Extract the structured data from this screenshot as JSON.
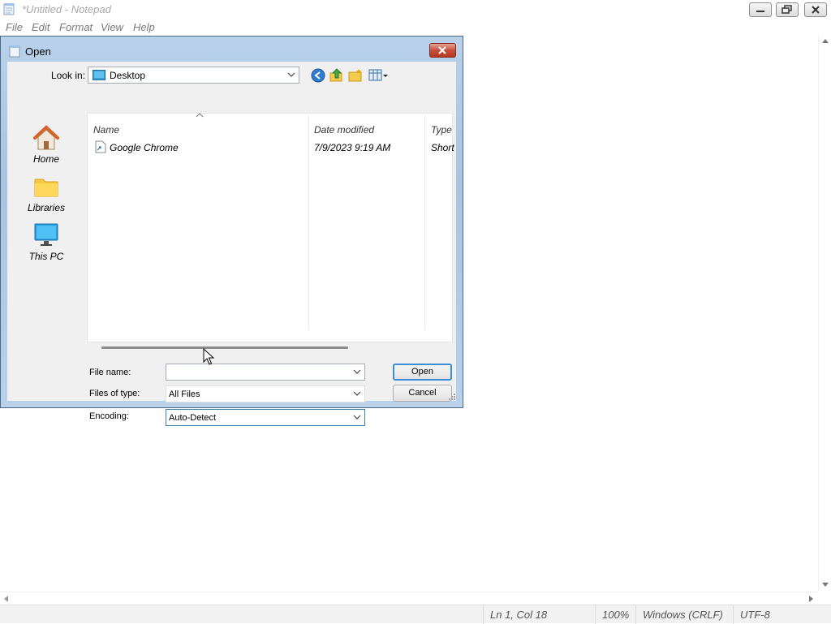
{
  "window": {
    "title": "*Untitled - Notepad",
    "menu": [
      "File",
      "Edit",
      "Format",
      "View",
      "Help"
    ]
  },
  "status_bar": {
    "position": "Ln 1, Col 18",
    "zoom": "100%",
    "line_endings": "Windows (CRLF)",
    "encoding": "UTF-8"
  },
  "dialog": {
    "title": "Open",
    "look_in_label": "Look in:",
    "look_in_value": "Desktop",
    "places": [
      {
        "label": "Home",
        "icon": "home-icon"
      },
      {
        "label": "Libraries",
        "icon": "folder-icon"
      },
      {
        "label": "This PC",
        "icon": "computer-icon"
      }
    ],
    "columns": {
      "name": "Name",
      "date": "Date modified",
      "type": "Type"
    },
    "files": [
      {
        "name": "Google Chrome",
        "date": "7/9/2023 9:19 AM",
        "type": "Short",
        "icon": "shortcut-icon"
      }
    ],
    "file_name_label": "File name:",
    "file_name_value": "",
    "files_of_type_label": "Files of type:",
    "files_of_type_value": "All Files",
    "encoding_label": "Encoding:",
    "encoding_value": "Auto-Detect",
    "open_button": "Open",
    "cancel_button": "Cancel"
  },
  "colors": {
    "dialog_frame": "#b9d1ea",
    "close_button": "#c7503c",
    "default_button_border": "#3c8cd6"
  }
}
